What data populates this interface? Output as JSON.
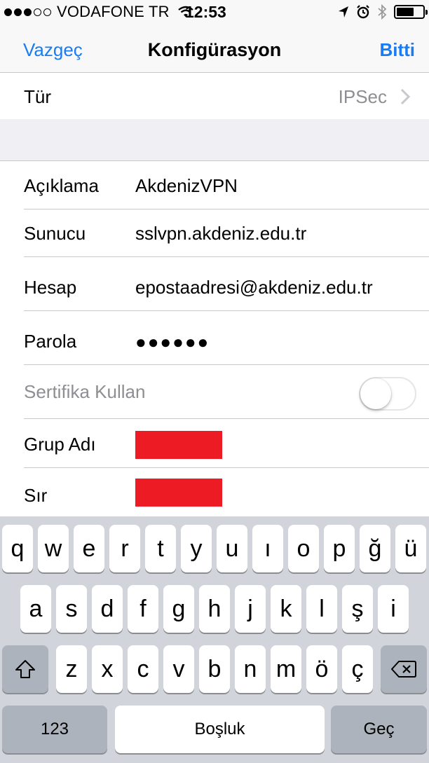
{
  "status_bar": {
    "carrier": "VODAFONE TR",
    "time": "12:53"
  },
  "nav": {
    "cancel": "Vazgeç",
    "title": "Konfigürasyon",
    "done": "Bitti"
  },
  "type_row": {
    "label": "Tür",
    "value": "IPSec"
  },
  "fields": {
    "description": {
      "label": "Açıklama",
      "value": "AkdenizVPN"
    },
    "server": {
      "label": "Sunucu",
      "value": "sslvpn.akdeniz.edu.tr"
    },
    "account": {
      "label": "Hesap",
      "value": "epostaadresi@akdeniz.edu.tr"
    },
    "password": {
      "label": "Parola",
      "value": "●●●●●●"
    },
    "certificate": {
      "label": "Sertifika Kullan",
      "enabled": false
    },
    "group_name": {
      "label": "Grup Adı"
    },
    "secret": {
      "label": "Sır"
    }
  },
  "keyboard": {
    "row1": [
      "q",
      "w",
      "e",
      "r",
      "t",
      "y",
      "u",
      "ı",
      "o",
      "p",
      "ğ",
      "ü"
    ],
    "row2": [
      "a",
      "s",
      "d",
      "f",
      "g",
      "h",
      "j",
      "k",
      "l",
      "ş",
      "i"
    ],
    "row3": [
      "z",
      "x",
      "c",
      "v",
      "b",
      "n",
      "m",
      "ö",
      "ç"
    ],
    "numbers": "123",
    "space": "Boşluk",
    "go": "Geç"
  },
  "colors": {
    "accent": "#1a7cf2",
    "redaction": "#ed1c24"
  }
}
